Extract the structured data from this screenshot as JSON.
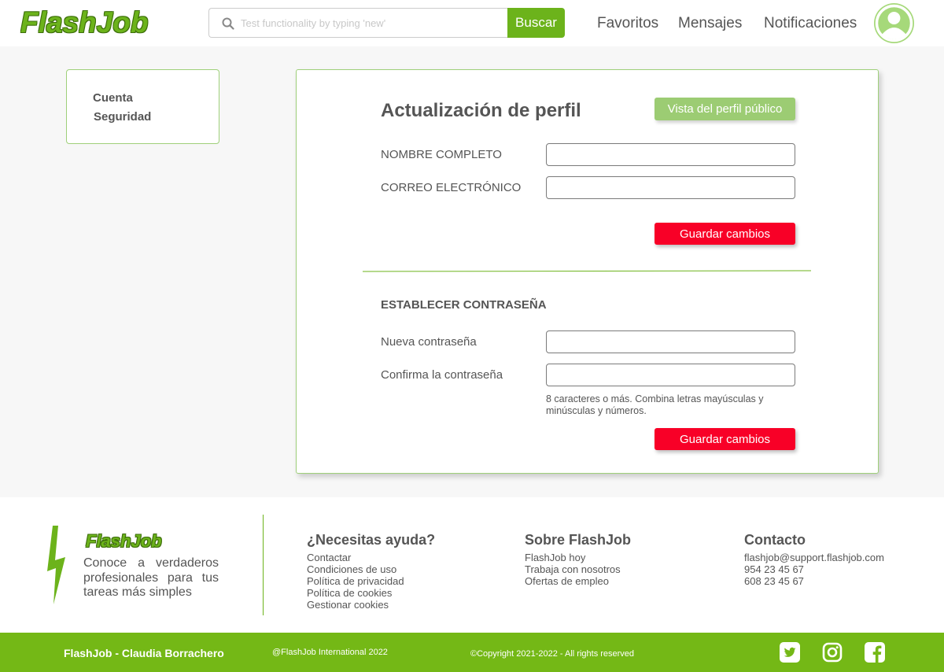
{
  "header": {
    "logo": "FlashJob",
    "search_placeholder": "Test functionality by typing 'new'",
    "search_button": "Buscar",
    "nav": {
      "favoritos": "Favoritos",
      "mensajes": "Mensajes",
      "notificaciones": "Notificaciones"
    }
  },
  "sidebar": {
    "items": [
      "Cuenta",
      "Seguridad"
    ]
  },
  "profile": {
    "title": "Actualización de perfil",
    "public_button": "Vista del perfil público",
    "name_label": "NOMBRE COMPLETO",
    "name_value": "",
    "email_label": "CORREO ELECTRÓNICO",
    "email_value": "",
    "save_button": "Guardar cambios"
  },
  "password": {
    "title": "ESTABLECER CONTRASEÑA",
    "new_label": "Nueva contraseña",
    "confirm_label": "Confirma la contraseña",
    "hint": "8 caracteres o más. Combina letras mayúsculas y minúsculas y números.",
    "save_button": "Guardar cambios"
  },
  "footer": {
    "logo": "FlashJob",
    "tagline": "Conoce a verdaderos profesionales para tus tareas más simples",
    "help": {
      "title": "¿Necesitas ayuda?",
      "links": [
        "Contactar",
        "Condiciones de uso",
        "Política de privacidad",
        "Política de cookies",
        "Gestionar cookies"
      ]
    },
    "about": {
      "title": "Sobre FlashJob",
      "links": [
        "FlashJob hoy",
        "Trabaja con nosotros",
        "Ofertas de empleo"
      ]
    },
    "contact": {
      "title": "Contacto",
      "items": [
        "flashjob@support.flashjob.com",
        "954 23 45 67",
        "608 23 45 67"
      ]
    }
  },
  "bottom_bar": {
    "author": "FlashJob - Claudia Borrachero",
    "international": "@FlashJob International 2022",
    "copyright": "©Copyright  2021-2022 - All rights reserved",
    "social_icons": [
      "twitter-icon",
      "instagram-icon",
      "facebook-icon"
    ]
  },
  "colors": {
    "brand_green": "#74b816",
    "save_red": "#f80027",
    "light_green": "#9ccc73"
  }
}
